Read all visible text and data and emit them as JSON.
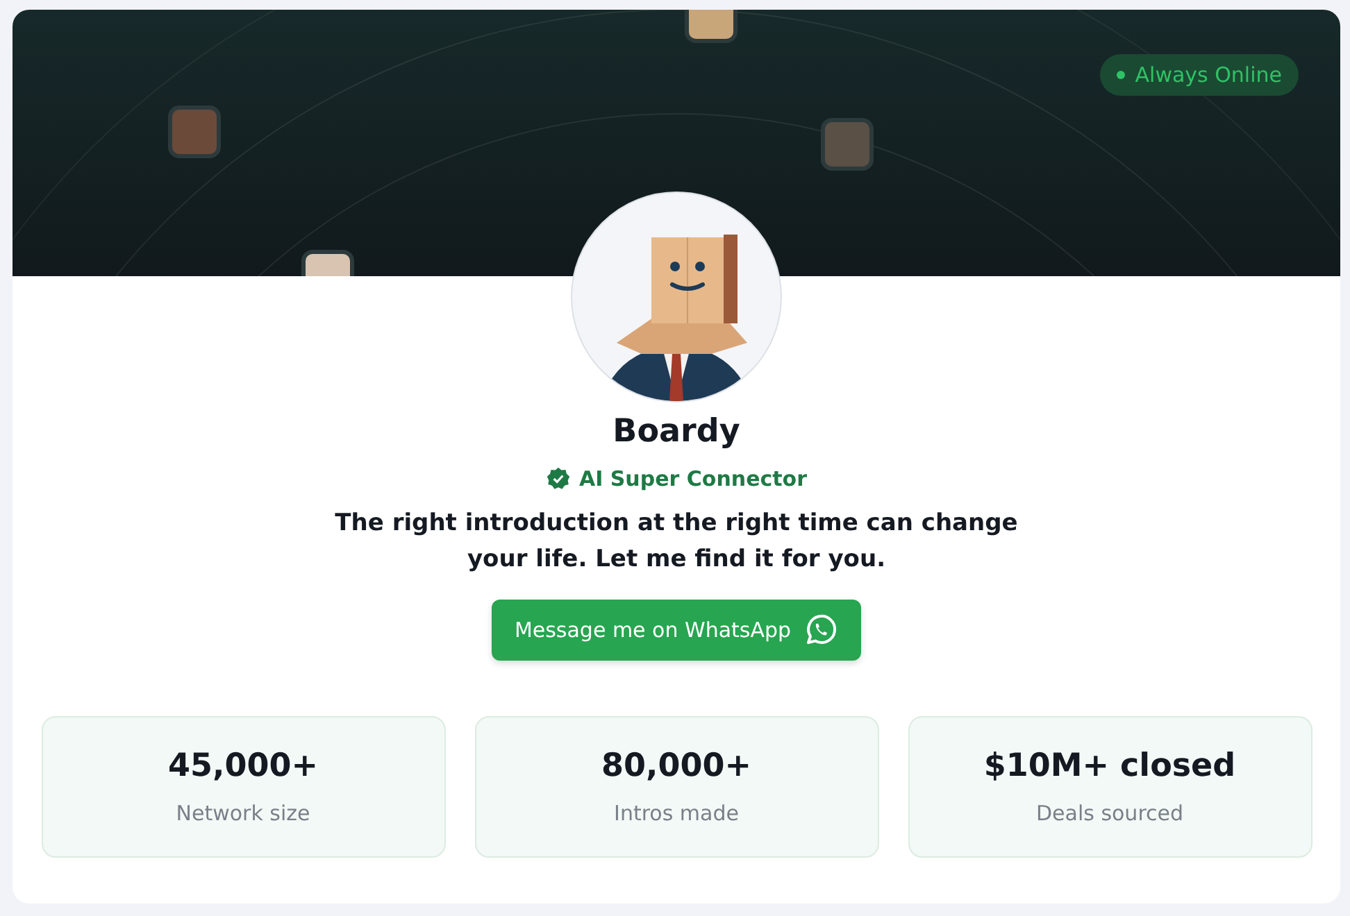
{
  "header": {
    "status": {
      "label": "Always Online",
      "online": true
    }
  },
  "profile": {
    "name": "Boardy",
    "verified": true,
    "badge": "AI Super Connector",
    "tagline": "The right introduction at the right time can change your life. Let me find it for you."
  },
  "cta_button": {
    "label": "Message me on WhatsApp"
  },
  "stats": [
    {
      "value": "45,000+",
      "label": "Network size"
    },
    {
      "value": "80,000+",
      "label": "Intros made"
    },
    {
      "value": "$10M+ closed",
      "label": "Deals sourced"
    }
  ]
}
